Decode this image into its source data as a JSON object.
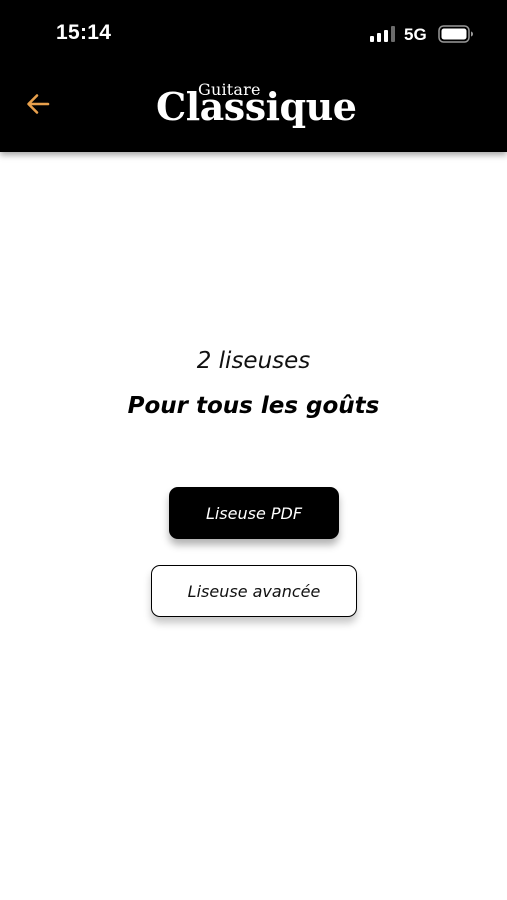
{
  "status_bar": {
    "time": "15:14",
    "network": "5G",
    "signal_icon": "cellular-signal-icon",
    "battery_icon": "battery-icon"
  },
  "header": {
    "back_icon": "arrow-left-icon",
    "logo_small": "Guitare",
    "logo_big": "Classique",
    "background_color": "#000000",
    "accent_color": "#e8a04c"
  },
  "main": {
    "subtitle": "2 liseuses",
    "title": "Pour tous les goûts",
    "buttons": {
      "pdf_reader": "Liseuse PDF",
      "advanced_reader": "Liseuse avancée"
    }
  }
}
